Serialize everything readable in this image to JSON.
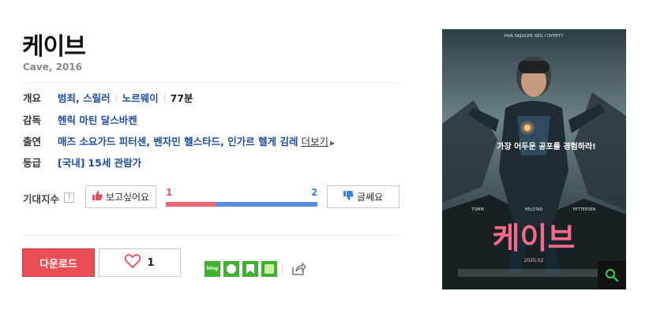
{
  "movie": {
    "title": "케이브",
    "subtitle": "Cave, 2016"
  },
  "info": {
    "overview_label": "개요",
    "genres": "범죄, 스릴러",
    "country": "노르웨이",
    "runtime": "77분",
    "director_label": "감독",
    "director": "헨릭 마틴 달스바켄",
    "cast_label": "출연",
    "cast": "매즈 소요가드 피터센, 벤자민 헬스타드, 인가르 헬게 김레",
    "more_label": "더보기",
    "rating_label": "등급",
    "rating_prefix": "[국내]",
    "rating": "15세 관람가"
  },
  "expectation": {
    "label": "기대지수",
    "help": "?",
    "want_button": "보고싶어요",
    "meh_button": "글쎄요",
    "want_count": "1",
    "meh_count": "2",
    "want_fraction": 0.33,
    "colors": {
      "want": "#f06473",
      "meh": "#5b8de3"
    }
  },
  "actions": {
    "download_label": "다운로드",
    "like_count": "1",
    "share_icons": [
      "blog-icon",
      "talk-icon",
      "bookmark-icon",
      "band-icon",
      "share-icon"
    ],
    "blog_text": "blog"
  },
  "poster": {
    "tagline_top": "HVA SKJULER SEG I DYPET?",
    "tagline_kr": "가장 어두운 공포를 경험하라!",
    "poster_title": "케이브",
    "release": "2020.02",
    "credit_left": "TOMM",
    "credit_mid": "HELSTAD",
    "credit_right": "PETTERSEN",
    "zoom_icon": "search-icon"
  }
}
